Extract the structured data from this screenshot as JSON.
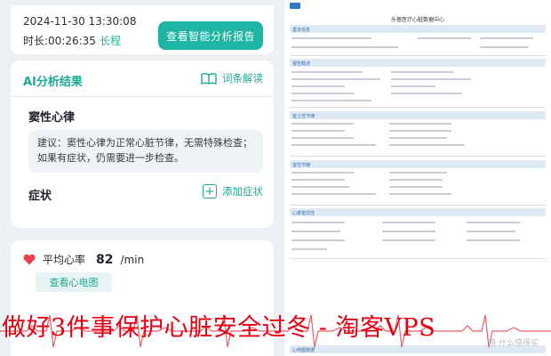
{
  "session": {
    "datetime": "2024-11-30 13:30:08",
    "duration_label": "时长:00:26:35",
    "duration_tag": "长程",
    "report_button": "查看智能分析报告"
  },
  "analysis": {
    "title": "AI分析结果",
    "glossary_label": "词条解读",
    "rhythm_title": "窦性心律",
    "advice_text": "建议：窦性心律为正常心脏节律，无需特殊检查；如果有症状，仍需要进一步检查。",
    "symptoms_title": "症状",
    "add_symptom_label": "添加症状"
  },
  "heart_rate": {
    "label": "平均心率",
    "value": "82",
    "unit": "/min",
    "ecg_button": "查看心电图"
  },
  "report": {
    "title": "乐普医疗心脏数据中心",
    "sections": {
      "basic": "基本信息",
      "overview": "报告概述",
      "rhythm": "室上性节律",
      "ventricular": "室性节律",
      "hrv": "心率变异性",
      "ecg": "心电图数据"
    }
  },
  "overlay": {
    "caption": "做好3件事保护心脏安全过冬 - 淘客VPS",
    "watermark": "值 什么值得买"
  },
  "colors": {
    "accent": "#1fb5a4",
    "overlay_red": "#e60012",
    "heart": "#e8414d"
  }
}
